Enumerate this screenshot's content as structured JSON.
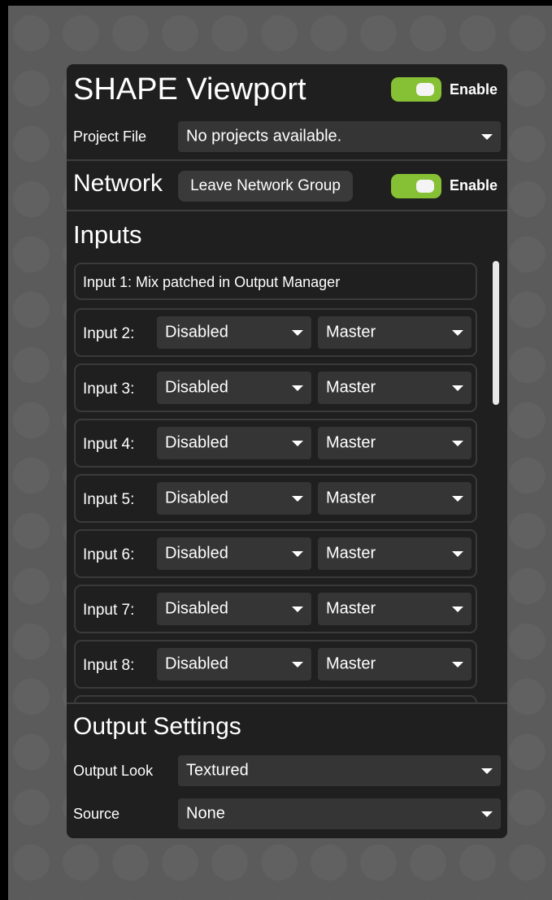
{
  "viewport": {
    "title": "SHAPE Viewport",
    "enable_label": "Enable",
    "enabled": true,
    "project_file_label": "Project File",
    "project_file_value": "No projects available."
  },
  "network": {
    "title": "Network",
    "leave_button": "Leave Network Group",
    "enable_label": "Enable",
    "enabled": true
  },
  "inputs": {
    "title": "Inputs",
    "input1_text": "Input 1: Mix patched in Output Manager",
    "rows": [
      {
        "label": "Input 2:",
        "mode": "Disabled",
        "target": "Master"
      },
      {
        "label": "Input 3:",
        "mode": "Disabled",
        "target": "Master"
      },
      {
        "label": "Input 4:",
        "mode": "Disabled",
        "target": "Master"
      },
      {
        "label": "Input 5:",
        "mode": "Disabled",
        "target": "Master"
      },
      {
        "label": "Input 6:",
        "mode": "Disabled",
        "target": "Master"
      },
      {
        "label": "Input 7:",
        "mode": "Disabled",
        "target": "Master"
      },
      {
        "label": "Input 8:",
        "mode": "Disabled",
        "target": "Master"
      }
    ]
  },
  "output_settings": {
    "title": "Output Settings",
    "look_label": "Output Look",
    "look_value": "Textured",
    "source_label": "Source",
    "source_value": "None"
  },
  "colors": {
    "toggle_on": "#86c034",
    "panel_bg": "#1f1f1f",
    "control_bg": "#353535"
  }
}
